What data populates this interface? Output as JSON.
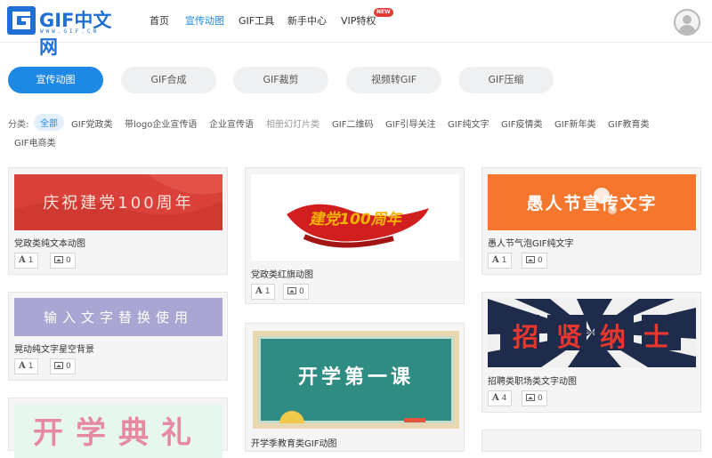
{
  "header": {
    "logo_text": "GIF中文网",
    "logo_sub": "WWW.GIF.CN",
    "nav": [
      "首页",
      "宣传动图",
      "GIF工具",
      "新手中心",
      "VIP特权"
    ],
    "new_badge": "NEW"
  },
  "tabs": [
    "宣传动图",
    "GIF合成",
    "GIF裁剪",
    "视频转GIF",
    "GIF压缩"
  ],
  "categories": {
    "label": "分类:",
    "items": [
      "全部",
      "GIF党政类",
      "带logo企业宣传语",
      "企业宣传语",
      "相册幻灯片类",
      "GIF二维码",
      "GIF引导关注",
      "GIF纯文字",
      "GIF疫情类",
      "GIF新年类",
      "GIF教育类",
      "GIF电商类"
    ]
  },
  "cards": [
    {
      "title": "党政类纯文本动图",
      "thumb_text": "庆祝建党100周年",
      "likes": "1",
      "images": "0",
      "colors": {
        "bg": "#d9413a",
        "text": "#fbe3da"
      }
    },
    {
      "title": "晃动纯文字星空背景",
      "thumb_text": "输入文字替换使用",
      "likes": "1",
      "images": "0",
      "colors": {
        "bg": "#a9a6d4",
        "text": "#ffffff"
      }
    },
    {
      "title": "",
      "thumb_text": "开学典礼",
      "likes": "",
      "images": "",
      "colors": {
        "bg": "#e8f6f0",
        "text": "#e58aa0"
      }
    },
    {
      "title": "党政类红旗动图",
      "thumb_text": "建党100周年",
      "likes": "1",
      "images": "0",
      "colors": {
        "bg": "#ffffff",
        "text": "#f2b400"
      }
    },
    {
      "title": "开学季教育类GIF动图",
      "thumb_text": "开学第一课",
      "likes": "",
      "images": "",
      "colors": {
        "bg": "#2f8c82",
        "text": "#ffffff"
      }
    },
    {
      "title": "愚人节气泡GIF纯文字",
      "thumb_text": "愚人节宣传文字",
      "likes": "1",
      "images": "0",
      "colors": {
        "bg": "#f5772e",
        "text": "#ffffff"
      }
    },
    {
      "title": "招聘类职场类文字动图",
      "thumb_text": "招贤纳士",
      "likes": "4",
      "images": "0",
      "colors": {
        "bg": "#1e2b4a",
        "text": "#e8372d"
      }
    }
  ]
}
